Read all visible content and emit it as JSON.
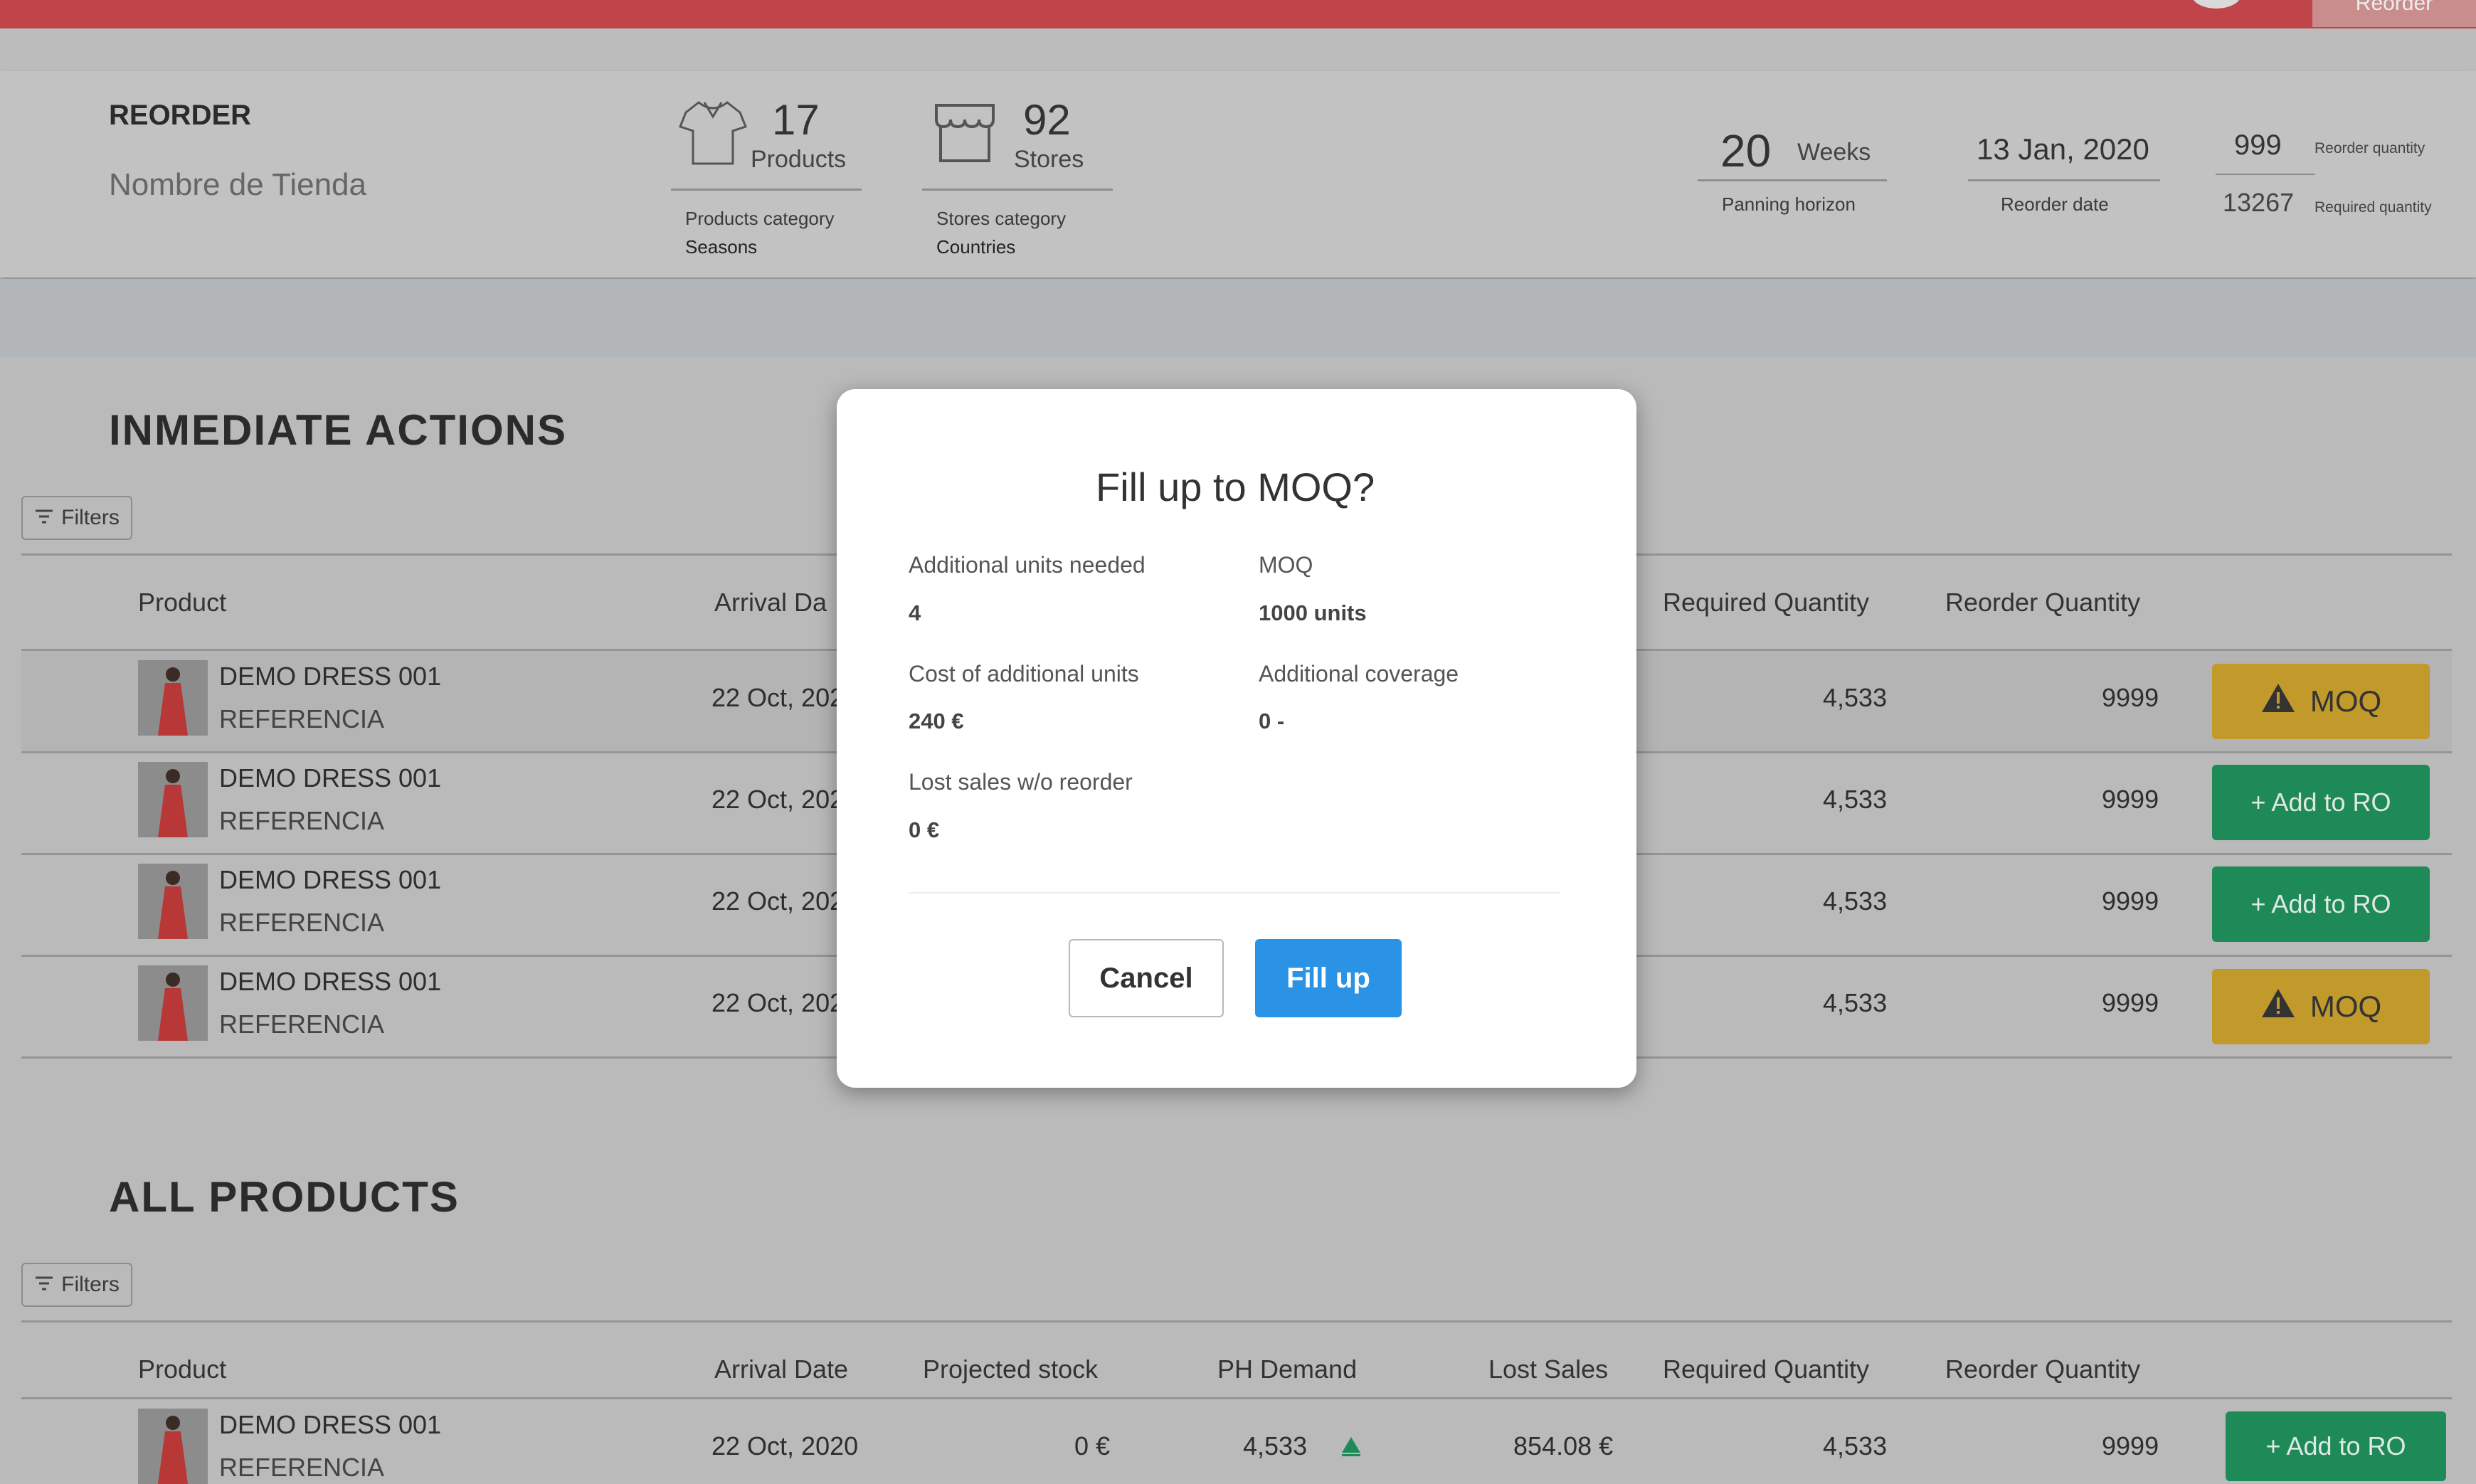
{
  "topbar": {
    "right_label": "Reorder"
  },
  "header": {
    "title": "REORDER",
    "store_name": "Nombre de Tienda",
    "products": {
      "count": "17",
      "unit": "Products",
      "category_label": "Products category",
      "category_value": "Seasons"
    },
    "stores": {
      "count": "92",
      "unit": "Stores",
      "category_label": "Stores category",
      "category_value": "Countries"
    },
    "planning": {
      "value": "20",
      "unit": "Weeks",
      "label": "Panning horizon"
    },
    "reorder_date": {
      "value": "13 Jan, 2020",
      "label": "Reorder date"
    },
    "quantities": {
      "reorder_value": "999",
      "reorder_label": "Reorder quantity",
      "required_value": "13267",
      "required_label": "Required quantity"
    }
  },
  "immediate": {
    "title": "INMEDIATE  ACTIONS",
    "filters_label": "Filters",
    "columns": {
      "product": "Product",
      "arrival": "Arrival Da",
      "required": "Required Quantity",
      "reorder": "Reorder Quantity"
    },
    "rows": [
      {
        "name": "DEMO DRESS 001",
        "ref": "REFERENCIA",
        "arrival": "22 Oct, 202",
        "required": "4,533",
        "reorder": "9999",
        "action": "MOQ"
      },
      {
        "name": "DEMO DRESS 001",
        "ref": "REFERENCIA",
        "arrival": "22 Oct, 202",
        "required": "4,533",
        "reorder": "9999",
        "action": "+ Add to RO"
      },
      {
        "name": "DEMO DRESS 001",
        "ref": "REFERENCIA",
        "arrival": "22 Oct, 202",
        "required": "4,533",
        "reorder": "9999",
        "action": "+ Add to RO"
      },
      {
        "name": "DEMO DRESS 001",
        "ref": "REFERENCIA",
        "arrival": "22 Oct, 202",
        "required": "4,533",
        "reorder": "9999",
        "action": "MOQ"
      }
    ]
  },
  "all_products": {
    "title": "ALL PRODUCTS",
    "filters_label": "Filters",
    "columns": {
      "product": "Product",
      "arrival": "Arrival Date",
      "projected": "Projected stock",
      "demand": "PH Demand",
      "lost": "Lost  Sales",
      "required": "Required Quantity",
      "reorder": "Reorder Quantity"
    },
    "rows": [
      {
        "name": "DEMO DRESS 001",
        "ref": "REFERENCIA",
        "arrival": "22 Oct, 2020",
        "projected": "0 €",
        "demand": "4,533",
        "lost": "854.08 €",
        "required": "4,533",
        "reorder": "9999",
        "action": "+ Add to RO"
      }
    ]
  },
  "modal": {
    "title": "Fill up to MOQ?",
    "fields": [
      {
        "label": "Additional units needed",
        "value": "4"
      },
      {
        "label": "MOQ",
        "value": "1000 units"
      },
      {
        "label": "Cost of additional units",
        "value": "240 €"
      },
      {
        "label": "Additional coverage",
        "value": "0 -"
      },
      {
        "label": "Lost sales w/o reorder",
        "value": "0 €"
      }
    ],
    "cancel_label": "Cancel",
    "fill_label": "Fill up"
  },
  "colors": {
    "moq": "#c29a2c",
    "add": "#1e8a57",
    "primary": "#2b93e6",
    "topbar": "#c0454b"
  },
  "icons": [
    "shirt-icon",
    "store-icon",
    "filter-icon",
    "warning-icon",
    "triangle-up-icon"
  ]
}
